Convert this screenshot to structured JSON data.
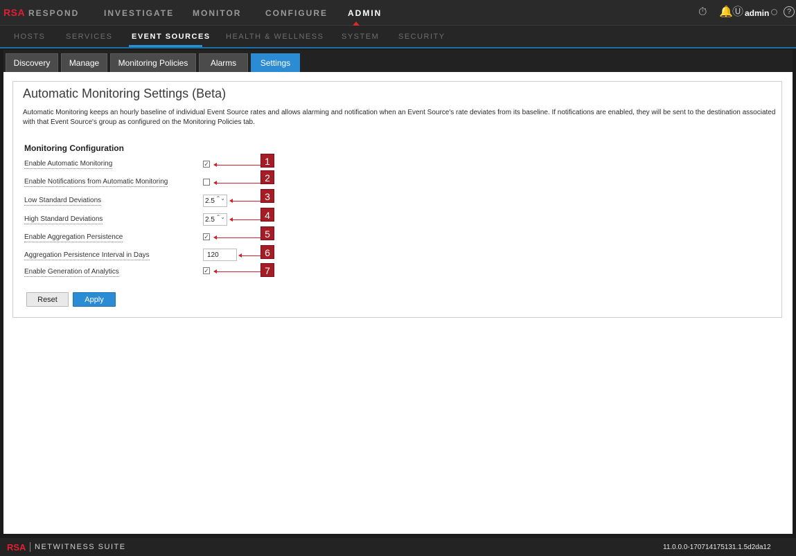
{
  "brand": {
    "logo": "RSA",
    "suite": "NETWITNESS SUITE",
    "version": "11.0.0.0-170714175131.1.5d2da12"
  },
  "topnav": {
    "items": [
      "RESPOND",
      "INVESTIGATE",
      "MONITOR",
      "CONFIGURE",
      "ADMIN"
    ],
    "active": "ADMIN",
    "user": "admin",
    "icons": [
      "stopwatch-icon",
      "bell-icon",
      "user-icon",
      "help-icon"
    ],
    "icon_glyphs": {
      "stopwatch": "⏱",
      "bell": "🔔",
      "user": "Ⓤ",
      "help": "?"
    }
  },
  "subnav": {
    "items": [
      "HOSTS",
      "SERVICES",
      "EVENT SOURCES",
      "HEALTH & WELLNESS",
      "SYSTEM",
      "SECURITY"
    ],
    "active": "EVENT SOURCES"
  },
  "tabs": {
    "items": [
      "Discovery",
      "Manage",
      "Monitoring Policies",
      "Alarms",
      "Settings"
    ],
    "active": "Settings"
  },
  "settings": {
    "title": "Automatic Monitoring Settings (Beta)",
    "description": "Automatic Monitoring keeps an hourly baseline of individual Event Source rates and allows alarming and notification when an Event Source's rate deviates from its baseline. If notifications are enabled, they will be sent to the destination associated with that Event Source's group as configured on the Monitoring Policies tab.",
    "section_title": "Monitoring Configuration",
    "rows": [
      {
        "label": "Enable Automatic Monitoring",
        "type": "checkbox",
        "checked": true,
        "callout": "1"
      },
      {
        "label": "Enable Notifications from Automatic Monitoring",
        "type": "checkbox",
        "checked": false,
        "callout": "2"
      },
      {
        "label": "Low Standard Deviations",
        "type": "spinner",
        "value": "2.5",
        "callout": "3"
      },
      {
        "label": "High Standard Deviations",
        "type": "spinner",
        "value": "2.5",
        "callout": "4"
      },
      {
        "label": "Enable Aggregation Persistence",
        "type": "checkbox",
        "checked": true,
        "callout": "5"
      },
      {
        "label": "Aggregation Persistence Interval in Days",
        "type": "number",
        "value": "120",
        "callout": "6"
      },
      {
        "label": "Enable Generation of Analytics",
        "type": "checkbox",
        "checked": true,
        "callout": "7"
      }
    ],
    "buttons": {
      "reset": "Reset",
      "apply": "Apply"
    },
    "glyphs": {
      "check": "✓",
      "spin": "⌃⌄"
    }
  },
  "colors": {
    "accent": "#2b8bd3",
    "callout": "#a51c24",
    "brand": "#e02030"
  }
}
